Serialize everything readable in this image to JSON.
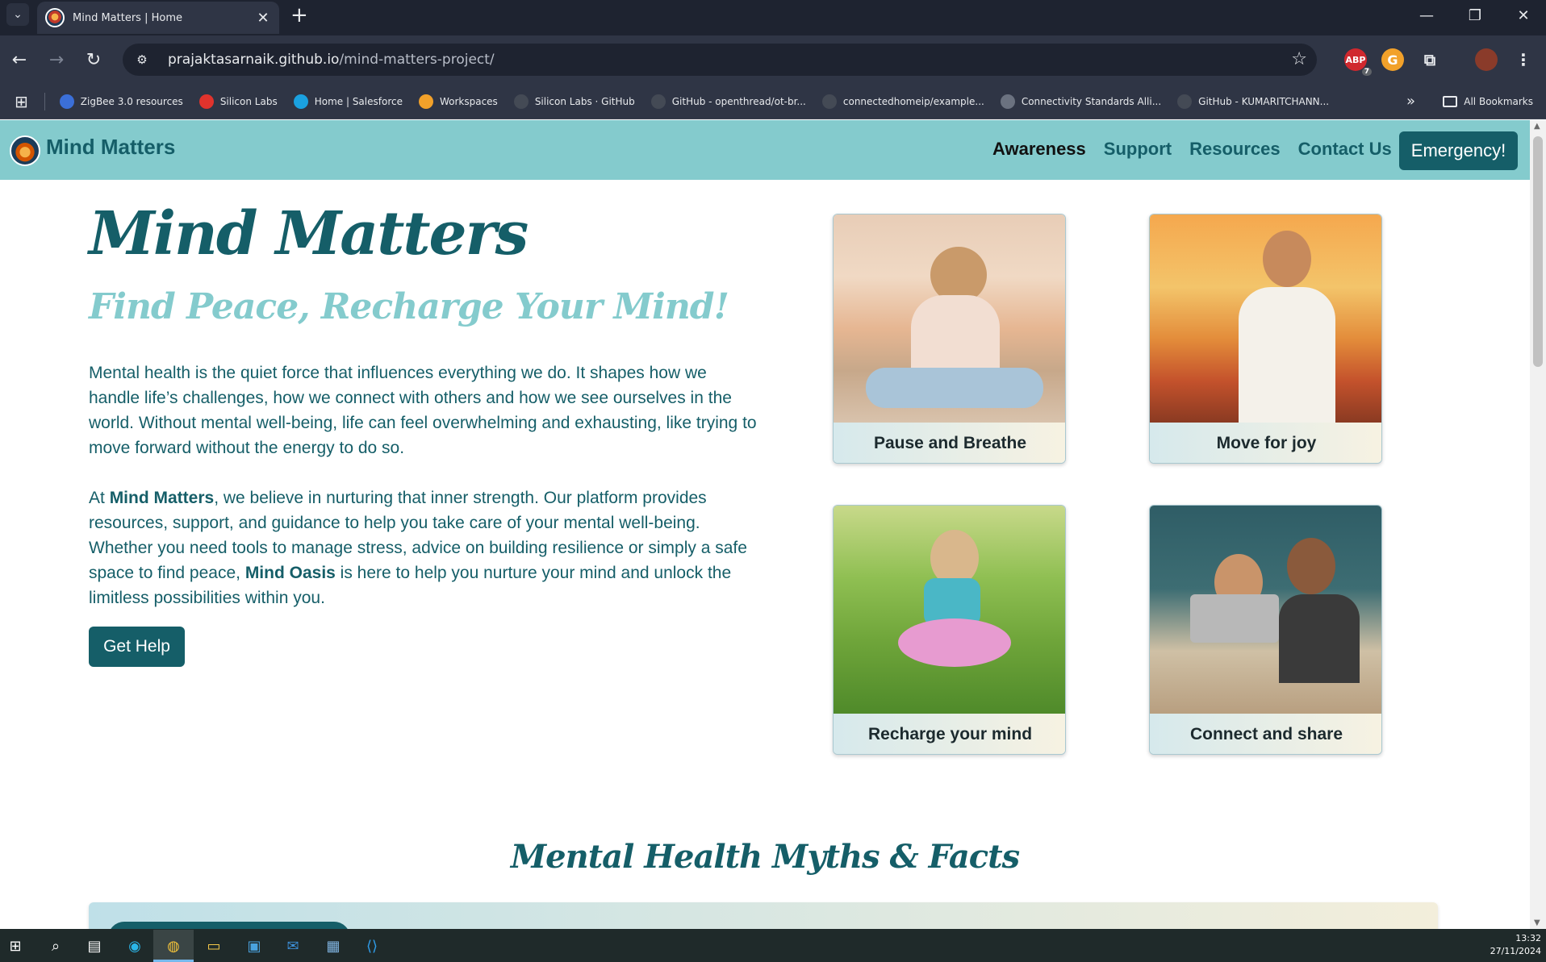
{
  "browser": {
    "tab_title": "Mind Matters | Home",
    "url_host": "prajaktasarnaik.github.io",
    "url_path": "/mind-matters-project/",
    "ext_badge": "7",
    "bookmarks": [
      {
        "label": "ZigBee 3.0 resources",
        "color": "#3b6fd8"
      },
      {
        "label": "Silicon Labs",
        "color": "#e0332d"
      },
      {
        "label": "Home | Salesforce",
        "color": "#1aa1e0"
      },
      {
        "label": "Workspaces",
        "color": "#f2a12a"
      },
      {
        "label": "Silicon Labs · GitHub",
        "color": "#444a55"
      },
      {
        "label": "GitHub - openthread/ot-br...",
        "color": "#444a55"
      },
      {
        "label": "connectedhomeip/example...",
        "color": "#444a55"
      },
      {
        "label": "Connectivity Standards Alli...",
        "color": "#6b7280"
      },
      {
        "label": "GitHub - KUMARITCHANN...",
        "color": "#444a55"
      }
    ],
    "all_bookmarks": "All Bookmarks"
  },
  "site": {
    "brand": "Mind Matters",
    "nav": [
      "Awareness",
      "Support",
      "Resources",
      "Contact Us"
    ],
    "emergency": "Emergency!",
    "hero_title": "Mind Matters",
    "hero_subtitle": "Find Peace, Recharge Your Mind!",
    "para1": "Mental health is the quiet force that influences everything we do. It shapes how we handle life’s challenges, how we connect with others and how we see ourselves in the world. Without mental well-being, life can feel overwhelming and exhausting, like trying to move forward without the energy to do so.",
    "para2_a": "At ",
    "para2_b": "Mind Matters",
    "para2_c": ", we believe in nurturing that inner strength. Our platform provides resources, support, and guidance to help you take care of your mental well-being. Whether you need tools to manage stress, advice on building resilience or simply a safe space to find peace, ",
    "para2_d": "Mind Oasis",
    "para2_e": " is here to help you nurture your mind and unlock the limitless possibilities within you.",
    "get_help": "Get Help",
    "cards": [
      "Pause and Breathe",
      "Move for joy",
      "Recharge your mind",
      "Connect and share"
    ],
    "section_title": "Mental Health Myths & Facts"
  },
  "taskbar": {
    "time": "13:32",
    "date": "27/11/2024"
  },
  "colors": {
    "brand_dark": "#155e68",
    "brand_light": "#84cbcd"
  }
}
